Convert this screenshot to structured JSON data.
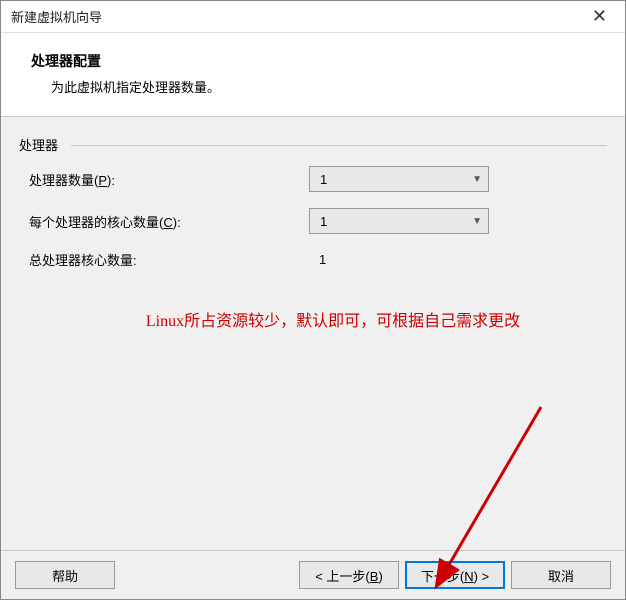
{
  "window": {
    "title": "新建虚拟机向导"
  },
  "header": {
    "title": "处理器配置",
    "subtitle": "为此虚拟机指定处理器数量。"
  },
  "group": {
    "label": "处理器"
  },
  "fields": {
    "processor_count_label": "处理器数量(P):",
    "processor_count_value": "1",
    "cores_per_label": "每个处理器的核心数量(C):",
    "cores_per_value": "1",
    "total_label": "总处理器核心数量:",
    "total_value": "1"
  },
  "annotation": "Linux所占资源较少，默认即可，可根据自己需求更改",
  "buttons": {
    "help": "帮助",
    "back": "< 上一步(B)",
    "next": "下一步(N) >",
    "cancel": "取消"
  }
}
